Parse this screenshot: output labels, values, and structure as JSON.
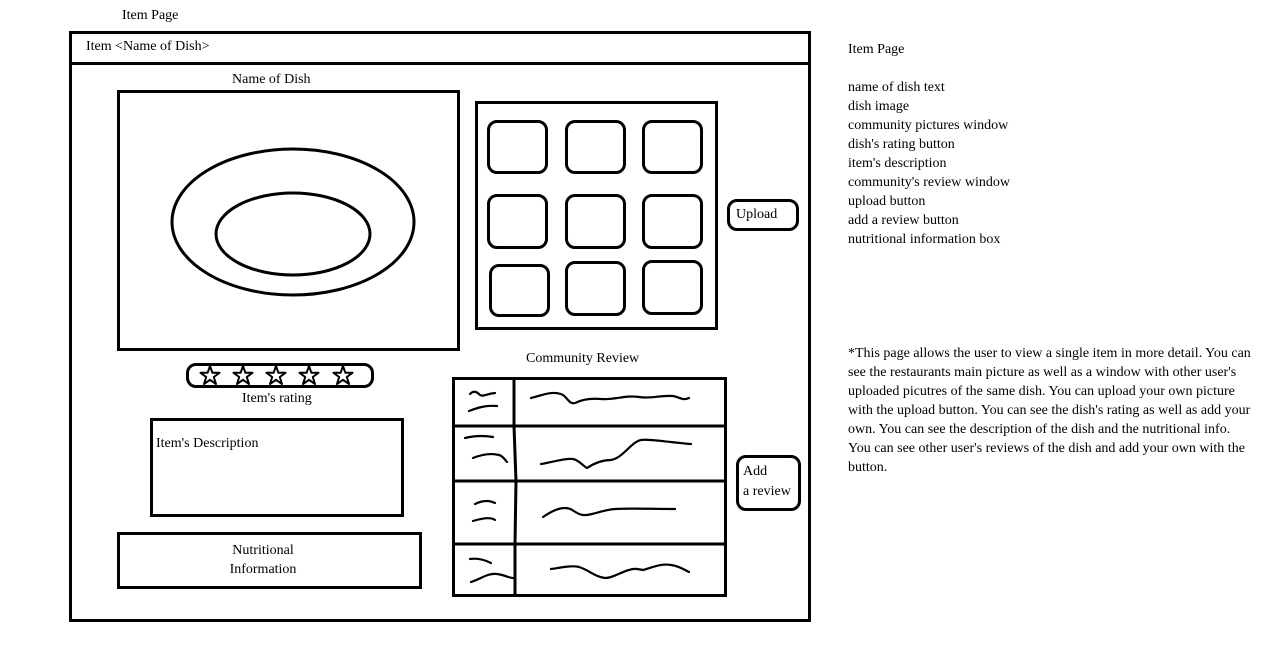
{
  "page_label": "Item Page",
  "window": {
    "title": "Item <Name of Dish>"
  },
  "dish": {
    "name": "Name of Dish",
    "image_icon": "plate-icon",
    "rating_label": "Item's rating",
    "rating_stars": 5,
    "description_label": "Item's Description",
    "nutrition_label_line1": "Nutritional",
    "nutrition_label_line2": "Information"
  },
  "community_pictures": {
    "thumbnail_count": 9,
    "upload_label": "Upload"
  },
  "community_review": {
    "title": "Community Review",
    "review_count": 4,
    "add_review_line1": "Add",
    "add_review_line2": "a review"
  },
  "notes": {
    "title": "Item Page",
    "items": [
      "name of dish text",
      "dish image",
      "community pictures window",
      "dish's rating button",
      "item's description",
      "community's review window",
      "upload button",
      "add a review button",
      "nutritional information box"
    ],
    "description": "*This page allows the user to view a single item in more detail. You can see the restaurants main picture as well as a window with other user's uploaded picutres of the same dish. You can upload your own picture with the upload button. You can see the dish's rating as well as add your own. You can see the description of the dish and the nutritional info. You can see other user's reviews of the dish and add your own with the button."
  }
}
